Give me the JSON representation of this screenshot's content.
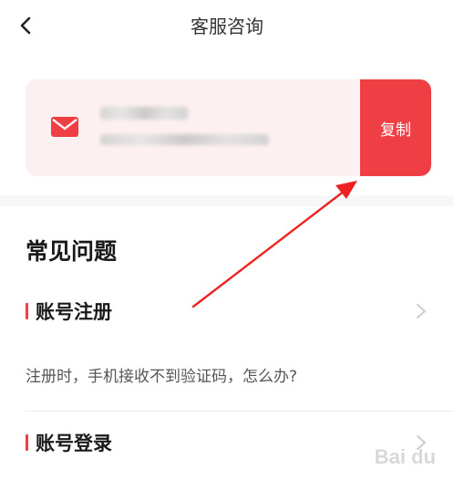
{
  "header": {
    "title": "客服咨询",
    "back_icon": "chevron-left-icon"
  },
  "contact": {
    "icon": "mail-icon",
    "accent_color": "#f03e45",
    "copy_label": "复制"
  },
  "faq": {
    "heading": "常见问题",
    "categories": [
      {
        "label": "账号注册",
        "questions": [
          "注册时，手机接收不到验证码，怎么办?"
        ]
      },
      {
        "label": "账号登录"
      }
    ]
  },
  "watermark": {
    "text": "Bai du"
  }
}
